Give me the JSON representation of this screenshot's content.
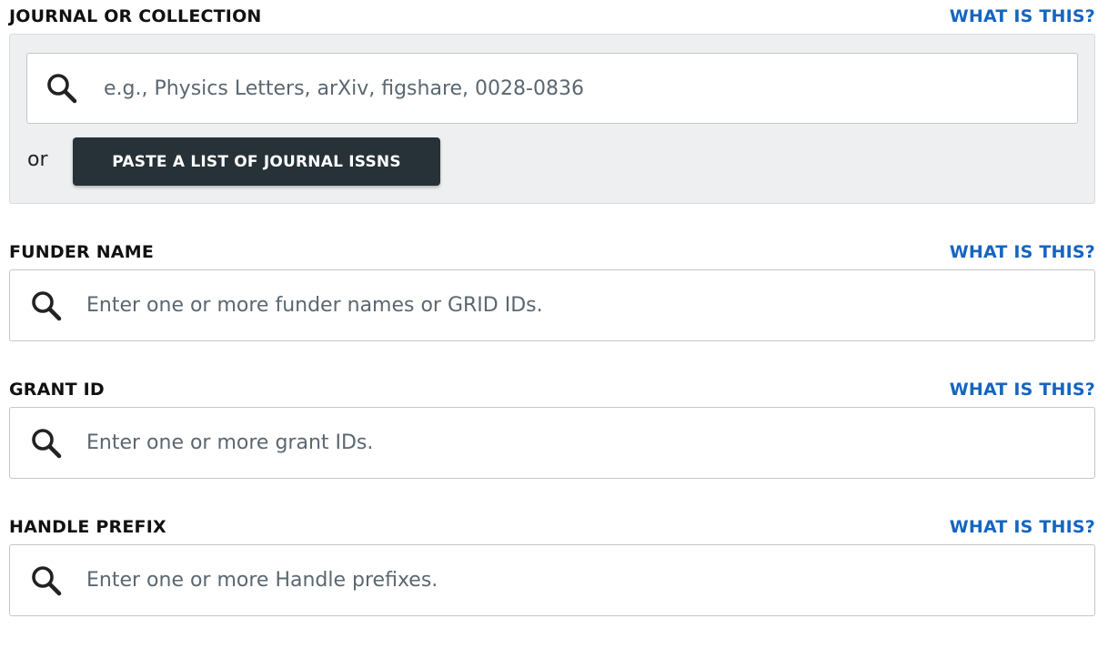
{
  "journal": {
    "title": "JOURNAL OR COLLECTION",
    "help_link": "WHAT IS THIS?",
    "search_placeholder": "e.g., Physics Letters, arXiv, figshare, 0028-0836",
    "search_value": "",
    "or_text": "or",
    "paste_button_label": "PASTE A LIST OF JOURNAL ISSNS"
  },
  "funder": {
    "title": "FUNDER NAME",
    "help_link": "WHAT IS THIS?",
    "search_placeholder": "Enter one or more funder names or GRID IDs.",
    "search_value": ""
  },
  "grant": {
    "title": "GRANT ID",
    "help_link": "WHAT IS THIS?",
    "search_placeholder": "Enter one or more grant IDs.",
    "search_value": ""
  },
  "handle": {
    "title": "HANDLE PREFIX",
    "help_link": "WHAT IS THIS?",
    "search_placeholder": "Enter one or more Handle prefixes.",
    "search_value": ""
  },
  "icons": {
    "search": "search-icon"
  },
  "colors": {
    "link": "#1565c0",
    "button_bg": "#263238",
    "panel_bg": "#eeeff0",
    "placeholder": "#5b6770"
  }
}
